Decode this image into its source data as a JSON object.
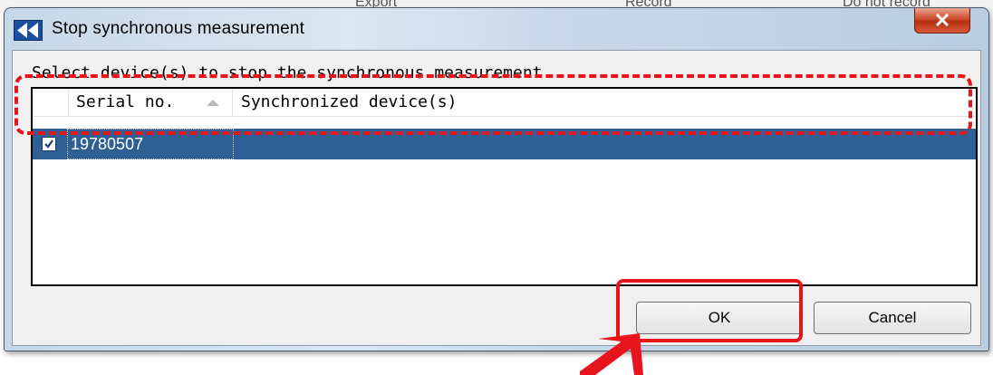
{
  "background": {
    "fragments": [
      "Export",
      "Record",
      "Do not record"
    ]
  },
  "dialog": {
    "title": "Stop synchronous measurement",
    "close_label": "X",
    "instruction": "Select device(s) to stop the synchronous measurement.",
    "columns": [
      "Serial no.",
      "Synchronized device(s)"
    ],
    "sort_column": "Serial no.",
    "rows": [
      {
        "checked": true,
        "selected": true,
        "serial": "19780507",
        "synchronized": ""
      }
    ],
    "buttons": {
      "ok": "OK",
      "cancel": "Cancel"
    }
  },
  "annotations": {
    "color": "#e8141c",
    "row_highlight": "dashed",
    "button_highlight": "solid",
    "arrow_target": "OK"
  }
}
